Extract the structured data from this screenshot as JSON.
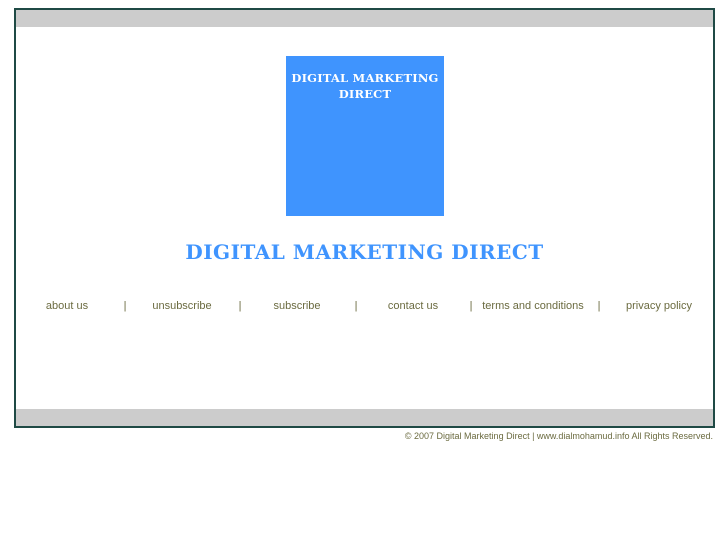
{
  "logo": {
    "line1": "DIGITAL MARKETING",
    "line2": "DIRECT"
  },
  "title": "DIGITAL MARKETING DIRECT",
  "nav": {
    "items": [
      "about us",
      "unsubscribe",
      "subscribe",
      "contact us",
      "terms and conditions",
      "privacy policy"
    ],
    "separator": "|"
  },
  "footer": "© 2007 Digital Marketing Direct | www.dialmohamud.info All Rights Reserved.",
  "colors": {
    "brand": "#3f94fe",
    "border": "#1f4a45",
    "band": "#cccccc",
    "link": "#6b6b40"
  }
}
